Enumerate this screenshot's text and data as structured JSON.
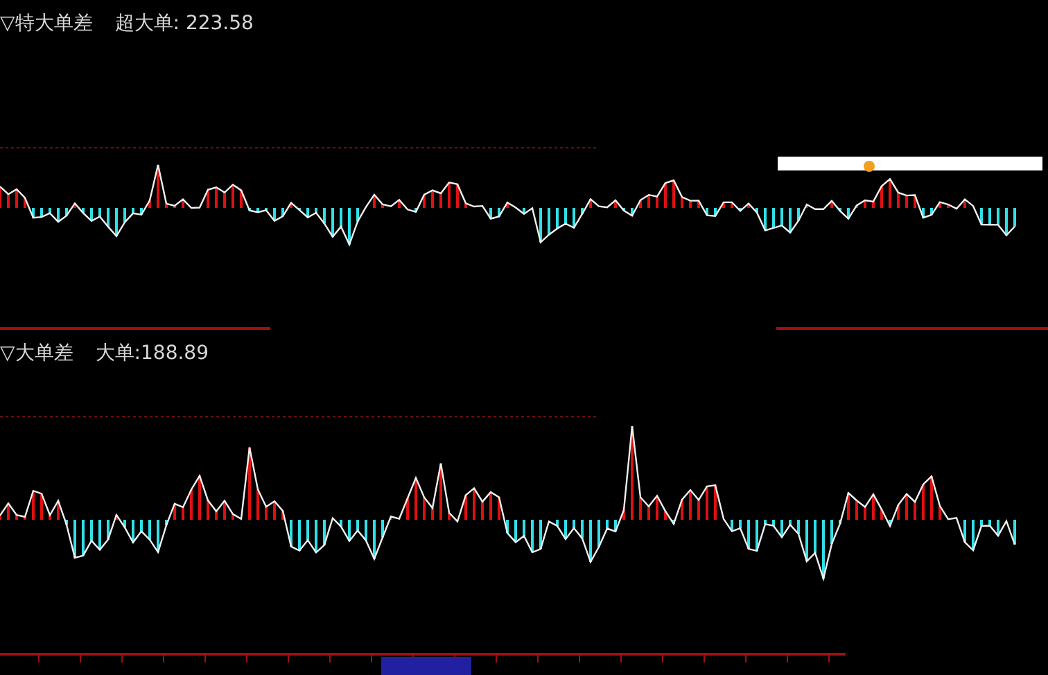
{
  "panels": [
    {
      "title": "▽特大单差",
      "reading": "超大单: 223.58"
    },
    {
      "title": "▽大单差",
      "reading": "大单:188.89"
    }
  ]
}
